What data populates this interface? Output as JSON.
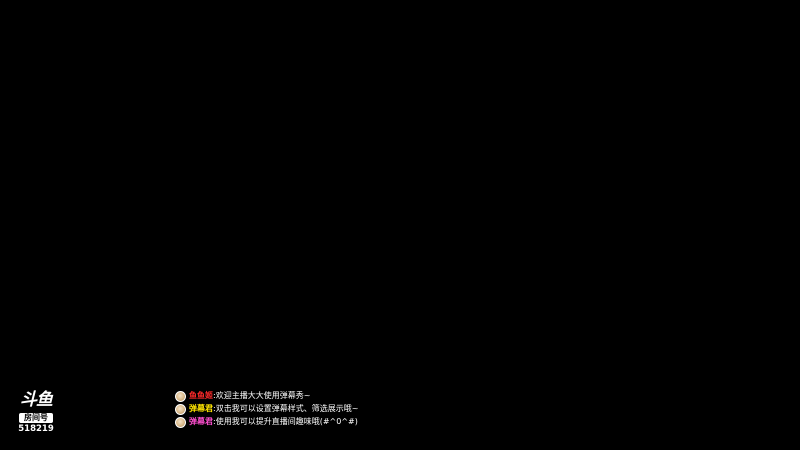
{
  "logo": {
    "brand": "斗鱼",
    "room_label": "房间号",
    "room_number": "518219"
  },
  "danmu": [
    {
      "sender": "鱼鱼姬",
      "sender_color": "#ff2a2a",
      "message": "欢迎主播大大使用弹幕秀~",
      "avatar": "user-avatar"
    },
    {
      "sender": "弹幕君",
      "sender_color": "#ffe600",
      "message": "双击我可以设置弹幕样式、筛选展示哦~",
      "avatar": "user-avatar"
    },
    {
      "sender": "弹幕君",
      "sender_color": "#ff4fd0",
      "message": "使用我可以提升直播间趣味哦(#^0^#)",
      "avatar": "user-avatar"
    }
  ]
}
